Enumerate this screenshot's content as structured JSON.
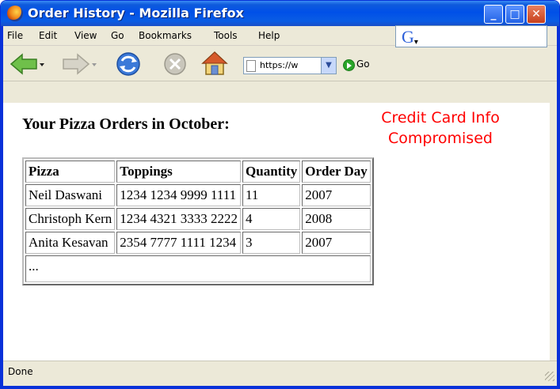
{
  "window": {
    "title": "Order History - Mozilla Firefox",
    "minimize": "_",
    "maximize": "□",
    "close": "✕"
  },
  "menu": [
    "File",
    "Edit",
    "View",
    "Go",
    "Bookmarks",
    "Tools",
    "Help"
  ],
  "navbar": {
    "url": "https://w",
    "go_label": "Go",
    "icons": [
      "back-arrow-icon",
      "forward-arrow-icon",
      "reload-icon",
      "stop-icon",
      "home-icon",
      "google-search-icon"
    ]
  },
  "page": {
    "heading": "Your Pizza Orders in October:",
    "annotation_line1": "Credit Card Info",
    "annotation_line2": "Compromised",
    "table": {
      "headers": [
        "Pizza",
        "Toppings",
        "Quantity",
        "Order Day"
      ],
      "rows": [
        [
          "Neil Daswani",
          "1234 1234 9999 1111",
          "11",
          "2007"
        ],
        [
          "Christoph Kern",
          "1234 4321 3333 2222",
          "4",
          "2008"
        ],
        [
          "Anita Kesavan",
          "2354 7777 1111 1234",
          "3",
          "2007"
        ]
      ],
      "ellipsis": "..."
    }
  },
  "status": {
    "text": "Done"
  },
  "colors": {
    "annotation": "#ff0000",
    "titlebar": "#0050e8"
  }
}
